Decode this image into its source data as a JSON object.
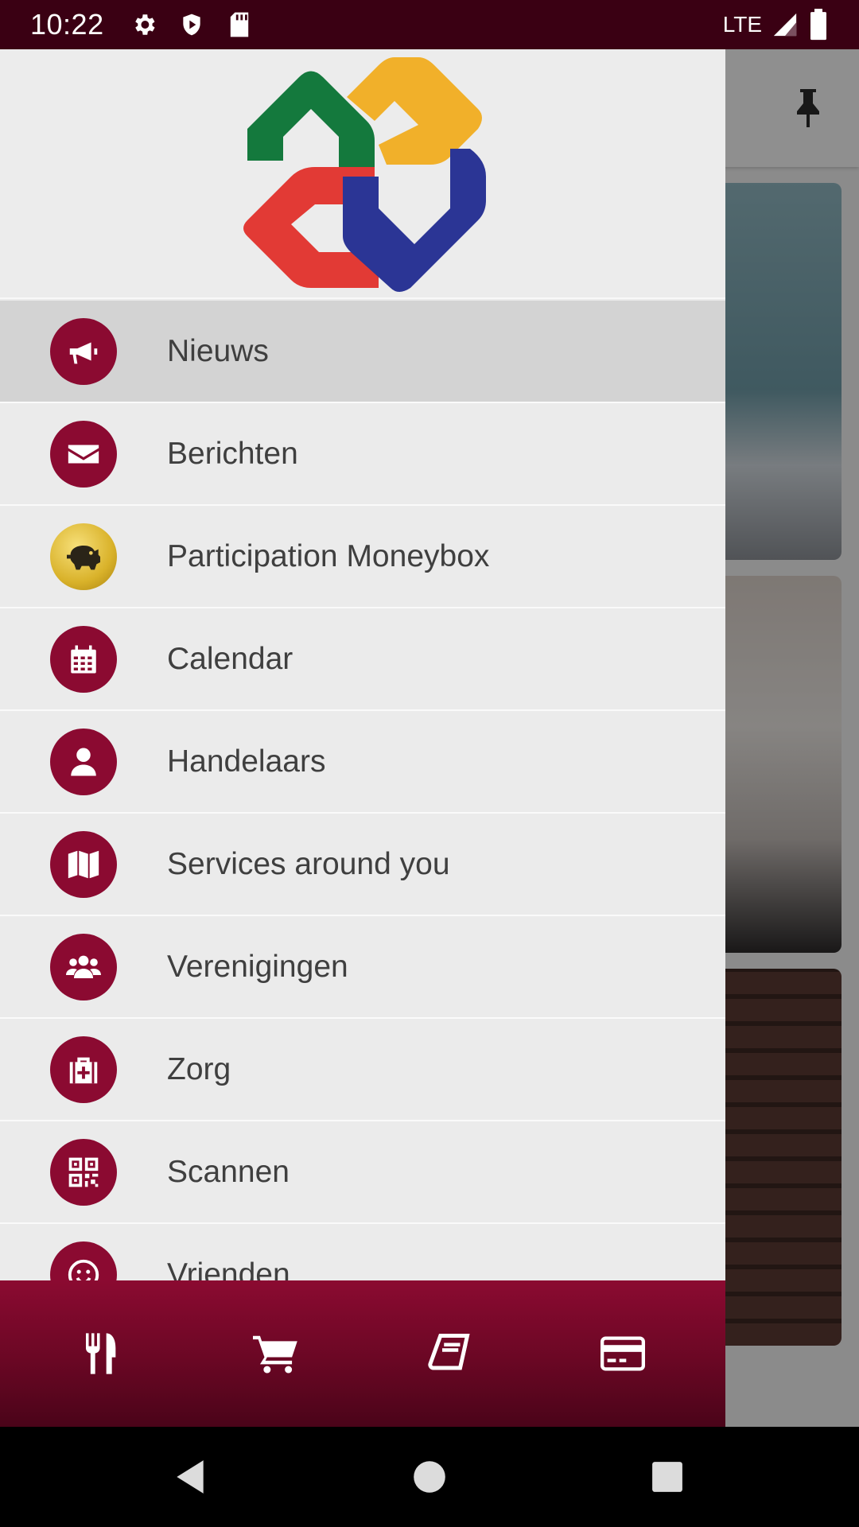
{
  "status_bar": {
    "time": "10:22",
    "network": "LTE",
    "icons": [
      "gear-icon",
      "shield-icon",
      "sd-card-icon",
      "signal-icon",
      "battery-icon"
    ]
  },
  "drawer": {
    "logo": "app-logo",
    "menu": [
      {
        "label": "Nieuws",
        "icon": "megaphone-icon",
        "active": true
      },
      {
        "label": "Berichten",
        "icon": "envelope-icon"
      },
      {
        "label": "Participation Moneybox",
        "icon": "piggy-bank-icon"
      },
      {
        "label": "Calendar",
        "icon": "calendar-icon"
      },
      {
        "label": "Handelaars",
        "icon": "user-icon"
      },
      {
        "label": "Services around you",
        "icon": "map-icon"
      },
      {
        "label": "Verenigingen",
        "icon": "group-icon"
      },
      {
        "label": "Zorg",
        "icon": "medical-kit-icon"
      },
      {
        "label": "Scannen",
        "icon": "qr-code-icon"
      },
      {
        "label": "Vrienden",
        "icon": "smiley-icon"
      }
    ],
    "bottom_nav": [
      "utensils-icon",
      "cart-icon",
      "book-icon",
      "credit-card-icon"
    ]
  },
  "colors": {
    "accent": "#8b0a31",
    "status_bar": "#3a0013",
    "drawer_bg": "#ebebeb",
    "active_item_bg": "#d3d3d3"
  }
}
